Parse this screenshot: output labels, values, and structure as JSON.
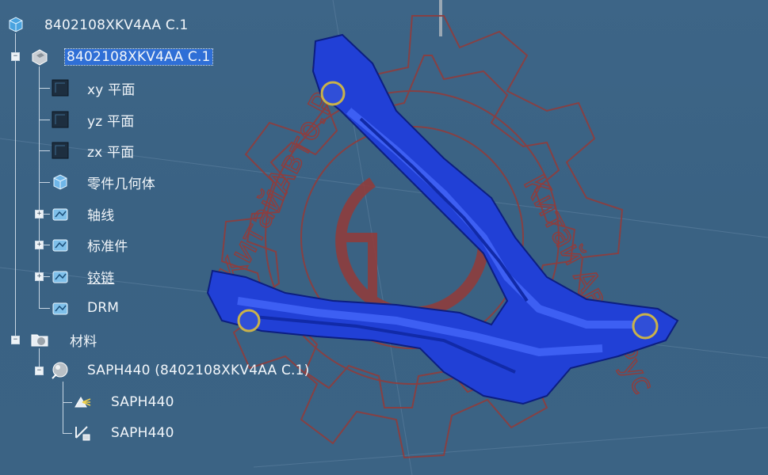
{
  "tree": {
    "root": {
      "label": "8402108XKV4AA C.1",
      "icon": "product-icon"
    },
    "part": {
      "label": "8402108XKV4AA C.1",
      "icon": "part-icon",
      "selected": true
    },
    "planes": [
      {
        "label": "xy 平面",
        "icon": "plane-icon"
      },
      {
        "label": "yz 平面",
        "icon": "plane-icon"
      },
      {
        "label": "zx 平面",
        "icon": "plane-icon"
      }
    ],
    "geometry": {
      "label": "零件几何体",
      "icon": "body-icon"
    },
    "sets": [
      {
        "label": "轴线",
        "icon": "geometrical-set-icon"
      },
      {
        "label": "标准件",
        "icon": "geometrical-set-icon"
      },
      {
        "label": "铰链",
        "icon": "geometrical-set-icon"
      },
      {
        "label": "DRM",
        "icon": "geometrical-set-icon"
      }
    ],
    "materials": {
      "label": "材料",
      "icon": "materials-folder-icon"
    },
    "material": {
      "label": "SAPH440 (8402108XKV4AA C.1)",
      "icon": "material-sphere-icon"
    },
    "material_children": [
      {
        "label": "SAPH440",
        "icon": "material-render-icon"
      },
      {
        "label": "SAPH440",
        "icon": "material-analysis-icon"
      }
    ]
  },
  "watermark": {
    "text_left": "КитайАвто.Ру",
    "text_right": "Китай Авто Рус"
  },
  "colors": {
    "background": "#3b6384",
    "part_blue": "#1f3fd8",
    "watermark": "#8a3b3b",
    "selection": "#2f6fd6"
  }
}
